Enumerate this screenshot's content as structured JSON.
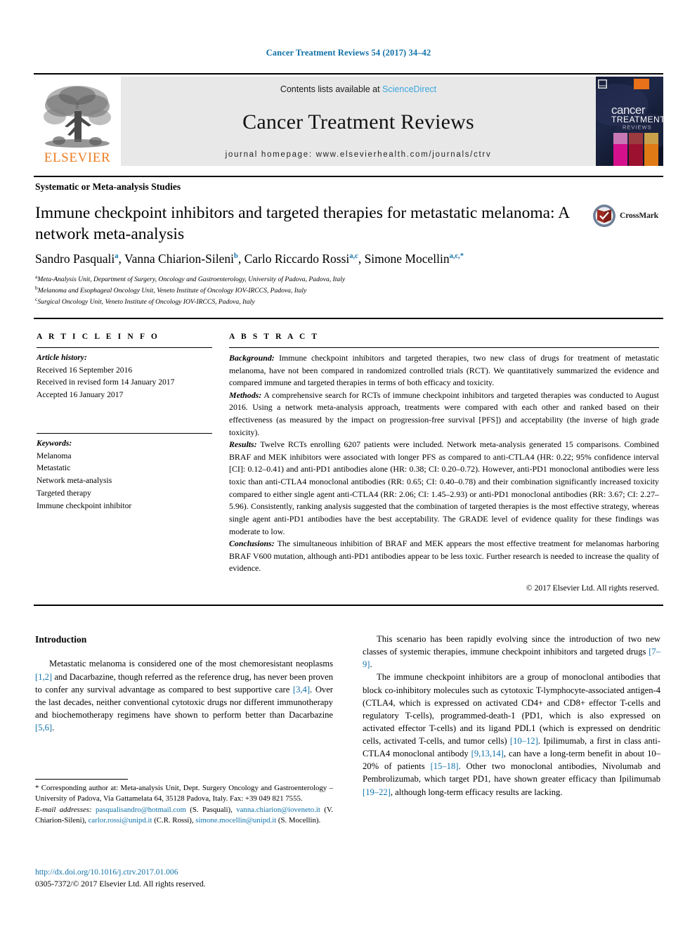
{
  "running_head": "Cancer Treatment Reviews 54 (2017) 34–42",
  "masthead": {
    "publisher_name": "ELSEVIER",
    "contents_prefix": "Contents lists available at ",
    "contents_link": "ScienceDirect",
    "journal_title": "Cancer Treatment Reviews",
    "homepage": "journal homepage: www.elsevierhealth.com/journals/ctrv",
    "cover": {
      "line1": "cancer",
      "line2": "TREATMENT",
      "line3": "REVIEWS"
    }
  },
  "article": {
    "section_label": "Systematic or Meta-analysis Studies",
    "title": "Immune checkpoint inhibitors and targeted therapies for metastatic melanoma: A network meta-analysis",
    "crossmark_label": "CrossMark",
    "authors": [
      {
        "name": "Sandro Pasquali",
        "marks": "a"
      },
      {
        "name": "Vanna Chiarion-Sileni",
        "marks": "b"
      },
      {
        "name": "Carlo Riccardo Rossi",
        "marks": "a,c"
      },
      {
        "name": "Simone Mocellin",
        "marks": "a,c,*"
      }
    ],
    "affiliations": [
      {
        "mark": "a",
        "text": "Meta-Analysis Unit, Department of Surgery, Oncology and Gastroenterology, University of Padova, Padova, Italy"
      },
      {
        "mark": "b",
        "text": "Melanoma and Esophageal Oncology Unit, Veneto Institute of Oncology IOV-IRCCS, Padova, Italy"
      },
      {
        "mark": "c",
        "text": "Surgical Oncology Unit, Veneto Institute of Oncology IOV-IRCCS, Padova, Italy"
      }
    ]
  },
  "article_info": {
    "heading": "A R T I C L E  I N F O",
    "history_label": "Article history:",
    "history": [
      "Received 16 September 2016",
      "Received in revised form 14 January 2017",
      "Accepted 16 January 2017"
    ],
    "keywords_label": "Keywords:",
    "keywords": [
      "Melanoma",
      "Metastatic",
      "Network meta-analysis",
      "Targeted therapy",
      "Immune checkpoint inhibitor"
    ]
  },
  "abstract": {
    "heading": "A B S T R A C T",
    "sections": [
      {
        "lead": "Background:",
        "text": " Immune checkpoint inhibitors and targeted therapies, two new class of drugs for treatment of metastatic melanoma, have not been compared in randomized controlled trials (RCT). We quantitatively summarized the evidence and compared immune and targeted therapies in terms of both efficacy and toxicity."
      },
      {
        "lead": "Methods:",
        "text": " A comprehensive search for RCTs of immune checkpoint inhibitors and targeted therapies was conducted to August 2016. Using a network meta-analysis approach, treatments were compared with each other and ranked based on their effectiveness (as measured by the impact on progression-free survival [PFS]) and acceptability (the inverse of high grade toxicity)."
      },
      {
        "lead": "Results:",
        "text": " Twelve RCTs enrolling 6207 patients were included. Network meta-analysis generated 15 comparisons. Combined BRAF and MEK inhibitors were associated with longer PFS as compared to anti-CTLA4 (HR: 0.22; 95% confidence interval [CI]: 0.12–0.41) and anti-PD1 antibodies alone (HR: 0.38; CI: 0.20–0.72). However, anti-PD1 monoclonal antibodies were less toxic than anti-CTLA4 monoclonal antibodies (RR: 0.65; CI: 0.40–0.78) and their combination significantly increased toxicity compared to either single agent anti-CTLA4 (RR: 2.06; CI: 1.45–2.93) or anti-PD1 monoclonal antibodies (RR: 3.67; CI: 2.27–5.96). Consistently, ranking analysis suggested that the combination of targeted therapies is the most effective strategy, whereas single agent anti-PD1 antibodies have the best acceptability. The GRADE level of evidence quality for these findings was moderate to low."
      },
      {
        "lead": "Conclusions:",
        "text": " The simultaneous inhibition of BRAF and MEK appears the most effective treatment for melanomas harboring BRAF V600 mutation, although anti-PD1 antibodies appear to be less toxic. Further research is needed to increase the quality of evidence."
      }
    ],
    "copyright": "© 2017 Elsevier Ltd. All rights reserved."
  },
  "body": {
    "left_heading": "Introduction",
    "left_paragraph_1_a": "Metastatic melanoma is considered one of the most chemoresistant neoplasms ",
    "left_ref_1": "[1,2]",
    "left_paragraph_1_b": " and Dacarbazine, though referred as the reference drug, has never been proven to confer any survival advantage as compared to best supportive care ",
    "left_ref_2": "[3,4]",
    "left_paragraph_1_c": ". Over the last decades, neither conventional cytotoxic drugs nor different immunotherapy and biochemotherapy regimens have shown to perform better than Dacarbazine ",
    "left_ref_3": "[5,6]",
    "left_paragraph_1_d": ".",
    "right_paragraph_1_a": "This scenario has been rapidly evolving since the introduction of two new classes of systemic therapies, immune checkpoint inhibitors and targeted drugs ",
    "right_ref_1": "[7–9]",
    "right_paragraph_1_b": ".",
    "right_paragraph_2_a": "The immune checkpoint inhibitors are a group of monoclonal antibodies that block co-inhibitory molecules such as cytotoxic T-lymphocyte-associated antigen-4 (CTLA4, which is expressed on activated CD4+ and CD8+ effector T-cells and regulatory T-cells), programmed-death-1 (PD1, which is also expressed on activated effector T-cells) and its ligand PDL1 (which is expressed on dendritic cells, activated T-cells, and tumor cells) ",
    "right_ref_2": "[10–12]",
    "right_paragraph_2_b": ". Ipilimumab, a first in class anti-CTLA4 monoclonal antibody ",
    "right_ref_3": "[9,13,14]",
    "right_paragraph_2_c": ", can have a long-term benefit in about 10–20% of patients ",
    "right_ref_4": "[15–18]",
    "right_paragraph_2_d": ". Other two monoclonal antibodies, Nivolumab and Pembrolizumab, which target PD1, have shown greater efficacy than Ipilimumab ",
    "right_ref_5": "[19–22]",
    "right_paragraph_2_e": ", although long-term efficacy results are lacking."
  },
  "footnote": {
    "corresponding": "* Corresponding author at: Meta-analysis Unit, Dept. Surgery Oncology and Gastroenterology – University of Padova, Via Gattamelata 64, 35128 Padova, Italy. Fax: +39 049 821 7555.",
    "email_label": "E-mail addresses:",
    "emails": [
      {
        "address": "pasqualisandro@hotmail.com",
        "owner": " (S. Pasquali), "
      },
      {
        "address": "vanna.chiarion@ioveneto.it",
        "owner": " (V. Chiarion-Sileni), "
      },
      {
        "address": "carlor.rossi@unipd.it",
        "owner": " (C.R. Rossi), "
      },
      {
        "address": "simone.mocellin@unipd.it",
        "owner": " (S. Mocellin)."
      }
    ]
  },
  "doi_block": {
    "doi": "http://dx.doi.org/10.1016/j.ctrv.2017.01.006",
    "issn_line": "0305-7372/© 2017 Elsevier Ltd. All rights reserved."
  },
  "colors": {
    "link_blue": "#1071a8",
    "sciencedirect_blue": "#3ca6dd",
    "elsevier_orange": "#ef7d22",
    "band_gray": "#e8e8e8"
  }
}
